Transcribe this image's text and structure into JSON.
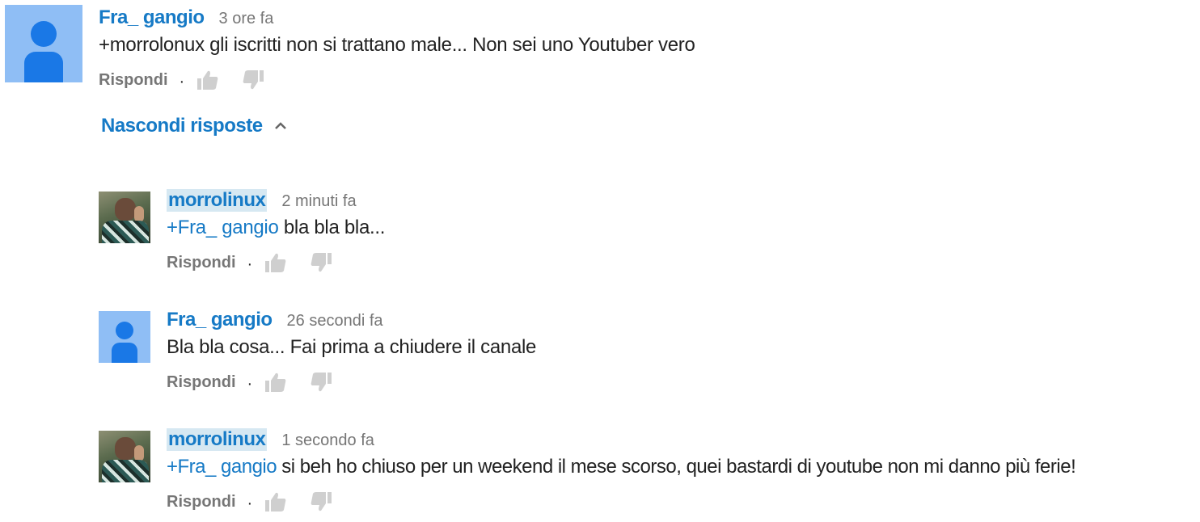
{
  "comments": [
    {
      "author": "Fra_ gangio",
      "time": "3 ore fa",
      "mention": "",
      "text": "+morrolonux gli iscritti non si trattano male... Non sei uno Youtuber vero",
      "reply_label": "Rispondi",
      "avatar": "default-avatar"
    }
  ],
  "toggle": {
    "label": "Nascondi risposte",
    "icon": "chevron-up-icon"
  },
  "replies": [
    {
      "author": "morrolinux",
      "time": "2 minuti fa",
      "mention": "+Fra_ gangio",
      "text": " bla bla bla...",
      "reply_label": "Rispondi",
      "avatar": "photo-avatar"
    },
    {
      "author": "Fra_ gangio",
      "time": "26 secondi fa",
      "mention": "",
      "text": "Bla bla cosa... Fai prima a chiudere il canale",
      "reply_label": "Rispondi",
      "avatar": "default-avatar"
    },
    {
      "author": "morrolinux",
      "time": "1 secondo fa",
      "mention": "+Fra_ gangio",
      "text": " si beh ho chiuso per un weekend il mese scorso, quei bastardi di youtube non mi danno più ferie!",
      "reply_label": "Rispondi",
      "avatar": "photo-avatar"
    }
  ],
  "colors": {
    "link": "#167ac6",
    "muted": "#767676",
    "text": "#222222",
    "avatar_bg": "#8fbef5",
    "avatar_fg": "#1a78e6",
    "highlight": "#d6e8f2"
  }
}
